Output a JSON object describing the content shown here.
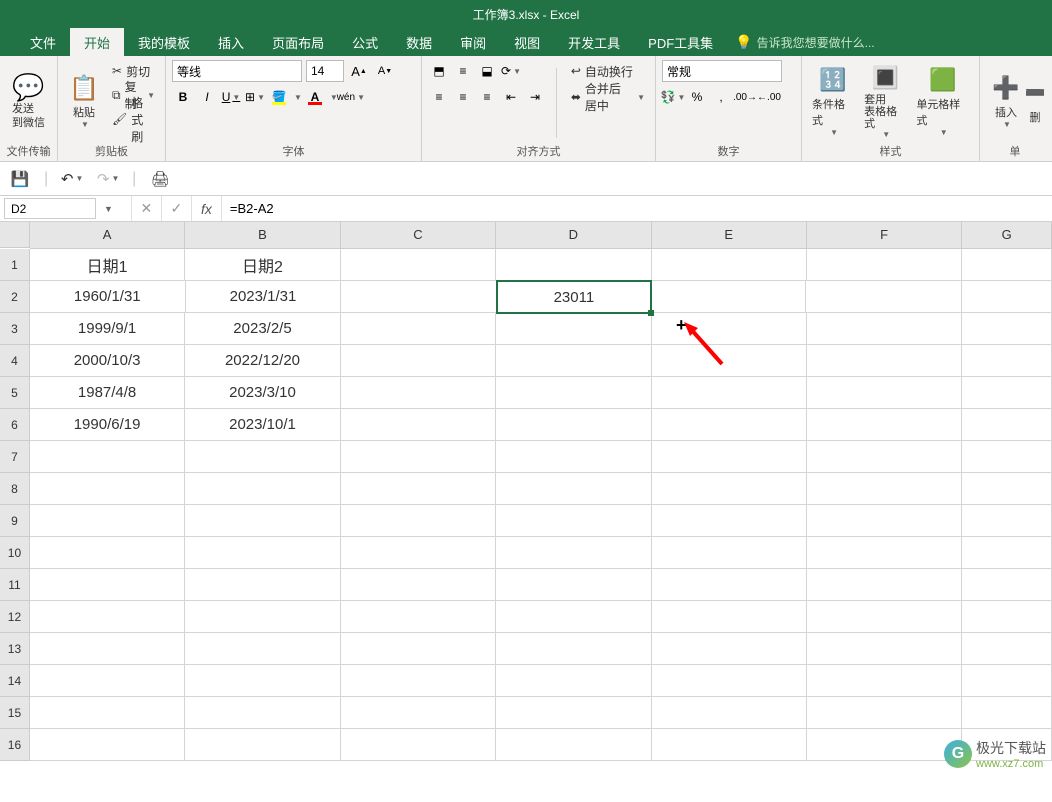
{
  "title": "工作簿3.xlsx - Excel",
  "menu": {
    "file": "文件",
    "home": "开始",
    "templates": "我的模板",
    "insert": "插入",
    "layout": "页面布局",
    "formulas": "公式",
    "data": "数据",
    "review": "审阅",
    "view": "视图",
    "dev": "开发工具",
    "pdf": "PDF工具集",
    "tellme": "告诉我您想要做什么..."
  },
  "ribbon": {
    "wechat": {
      "label": "发送\n到微信",
      "group": "文件传输"
    },
    "clipboard": {
      "paste": "粘贴",
      "cut": "剪切",
      "copy": "复制",
      "painter": "格式刷",
      "group": "剪贴板"
    },
    "font": {
      "name": "等线",
      "size": "14",
      "group": "字体"
    },
    "align": {
      "wrap": "自动换行",
      "merge": "合并后居中",
      "group": "对齐方式"
    },
    "number": {
      "format": "常规",
      "group": "数字"
    },
    "styles": {
      "cond": "条件格式",
      "table": "套用\n表格格式",
      "cellstyle": "单元格样式",
      "group": "样式"
    },
    "cells": {
      "insert": "插入",
      "delete": "删",
      "group": "单"
    }
  },
  "name_box": "D2",
  "formula": "=B2-A2",
  "columns": [
    "A",
    "B",
    "C",
    "D",
    "E",
    "F",
    "G"
  ],
  "rows": [
    "1",
    "2",
    "3",
    "4",
    "5",
    "6",
    "7",
    "8",
    "9",
    "10",
    "11",
    "12",
    "13",
    "14",
    "15",
    "16"
  ],
  "grid": {
    "headers": [
      "日期1",
      "日期2"
    ],
    "data": [
      {
        "a": "1960/1/31",
        "b": "2023/1/31",
        "d": "23011"
      },
      {
        "a": "1999/9/1",
        "b": "2023/2/5",
        "d": ""
      },
      {
        "a": "2000/10/3",
        "b": "2022/12/20",
        "d": ""
      },
      {
        "a": "1987/4/8",
        "b": "2023/3/10",
        "d": ""
      },
      {
        "a": "1990/6/19",
        "b": "2023/10/1",
        "d": ""
      }
    ]
  },
  "watermark": {
    "text": "极光下载站",
    "url": "www.xz7.com"
  }
}
